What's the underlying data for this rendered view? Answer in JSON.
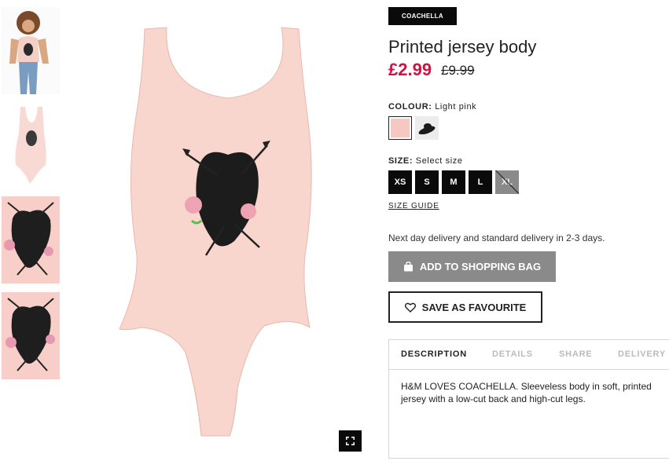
{
  "product": {
    "badge": "COACHELLA",
    "title": "Printed jersey body",
    "price": "£2.99",
    "old_price": "£9.99"
  },
  "colour": {
    "label": "COLOUR:",
    "value": "Light pink",
    "swatches": [
      "Light pink",
      "Hat print"
    ],
    "swatch_color": "#f5c9c1"
  },
  "size": {
    "label": "SIZE:",
    "value": "Select size",
    "options": [
      "XS",
      "S",
      "M",
      "L",
      "XL"
    ],
    "unavailable": [
      "XL"
    ],
    "guide_label": "SIZE GUIDE"
  },
  "delivery_note": "Next day delivery and standard delivery in 2-3 days.",
  "actions": {
    "add_to_bag": "ADD TO SHOPPING BAG",
    "save_favourite": "SAVE AS FAVOURITE"
  },
  "tabs": {
    "items": [
      "DESCRIPTION",
      "DETAILS",
      "SHARE",
      "DELIVERY"
    ],
    "active": "DESCRIPTION",
    "description_text": "H&M LOVES COACHELLA. Sleeveless body in soft, printed jersey with a low-cut back and high-cut legs."
  },
  "colors": {
    "accent_price": "#d01345",
    "body_pink": "#f5c9c1",
    "button_grey": "#8a8a8a",
    "black": "#0a0a0a"
  },
  "icons": {
    "bag": "shopping-bag-icon",
    "heart": "heart-outline-icon",
    "expand": "expand-icon"
  }
}
